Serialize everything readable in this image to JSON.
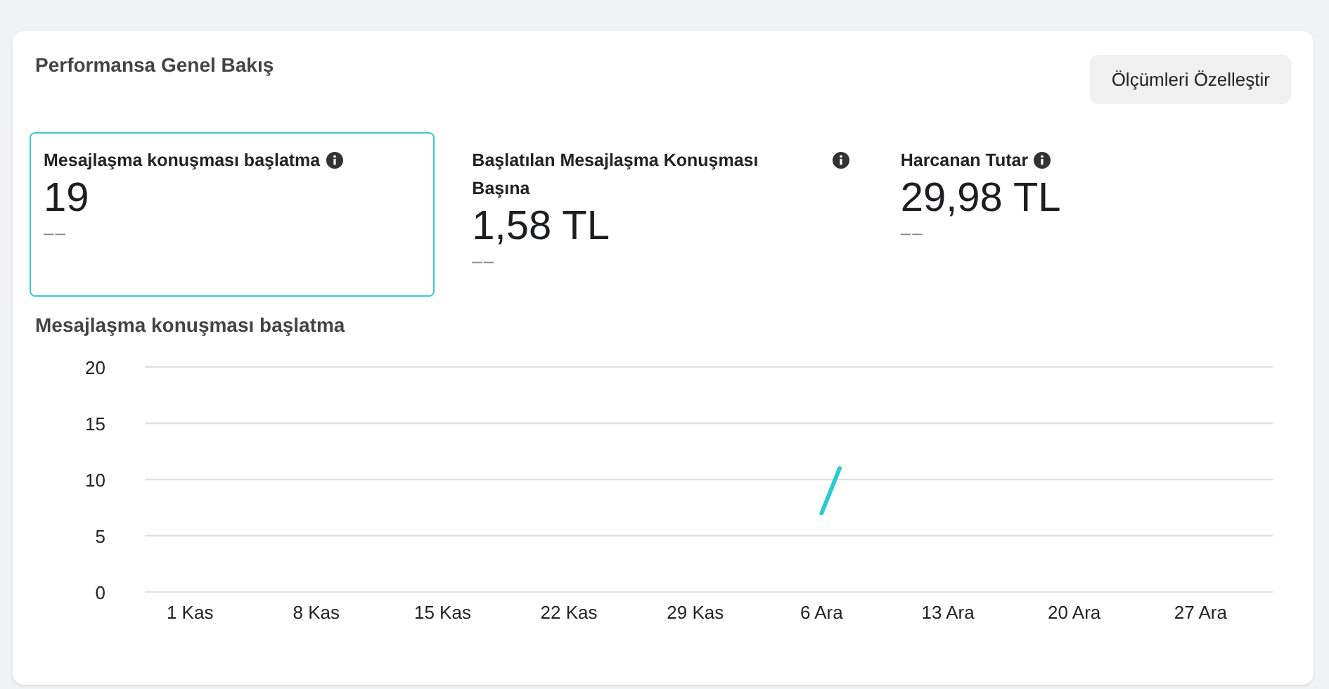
{
  "panel": {
    "title": "Performansa Genel Bakış",
    "customize_button": "Ölçümleri Özelleştir"
  },
  "metrics": [
    {
      "label": "Mesajlaşma konuşması başlatma",
      "value": "19",
      "change": "––",
      "selected": true
    },
    {
      "label": "Başlatılan Mesajlaşma Konuşması Başına",
      "value": "1,58 TL",
      "change": "––",
      "selected": false
    },
    {
      "label": "Harcanan Tutar",
      "value": "29,98 TL",
      "change": "––",
      "selected": false
    }
  ],
  "chart": {
    "title": "Mesajlaşma konuşması başlatma",
    "chart_data": {
      "type": "line",
      "categories": [
        "1 Kas",
        null,
        null,
        null,
        null,
        null,
        null,
        "8 Kas",
        null,
        null,
        null,
        null,
        null,
        null,
        "15 Kas",
        null,
        null,
        null,
        null,
        null,
        null,
        "22 Kas",
        null,
        null,
        null,
        null,
        null,
        null,
        "29 Kas",
        null,
        null,
        null,
        null,
        null,
        null,
        "6 Ara",
        null,
        null,
        null,
        null,
        null,
        null,
        "13 Ara",
        null,
        null,
        null,
        null,
        null,
        null,
        "20 Ara",
        null,
        null,
        null,
        null,
        null,
        null,
        "27 Ara",
        null,
        null,
        null
      ],
      "series": [
        {
          "color": "#2ccbcb",
          "values": [
            null,
            null,
            null,
            null,
            null,
            null,
            null,
            null,
            null,
            null,
            null,
            null,
            null,
            null,
            null,
            null,
            null,
            null,
            null,
            null,
            null,
            null,
            null,
            null,
            null,
            null,
            null,
            null,
            null,
            null,
            null,
            null,
            null,
            null,
            null,
            7,
            11,
            null,
            null,
            null,
            null,
            null,
            null,
            null,
            null,
            null,
            null,
            null,
            null,
            null,
            null,
            null,
            null,
            null,
            null,
            null,
            null,
            null,
            null,
            null
          ]
        }
      ],
      "ylim": [
        0,
        20
      ],
      "grid": true,
      "yticks": [
        0,
        5,
        10,
        15,
        20
      ]
    }
  }
}
